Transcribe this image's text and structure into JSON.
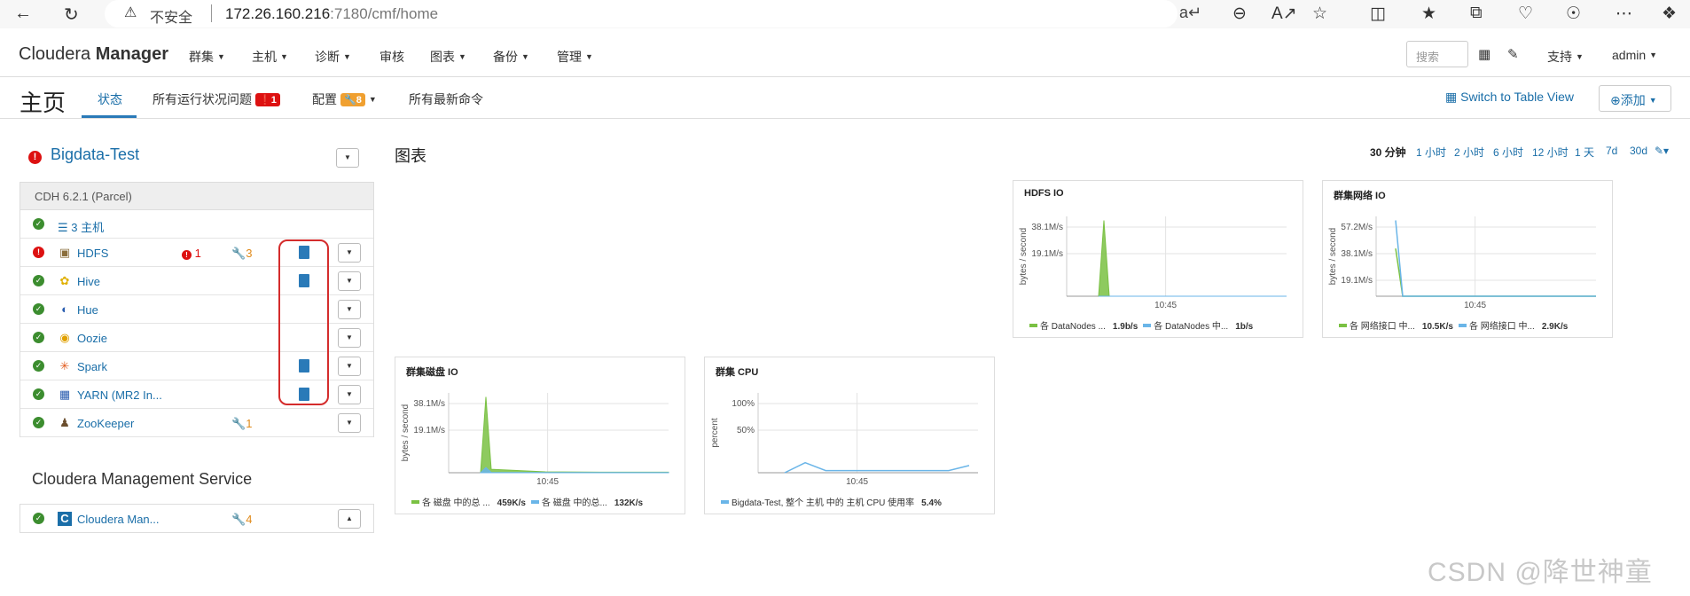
{
  "browser": {
    "security_warning": "不安全",
    "url_host": "172.26.160.216",
    "url_path": ":7180/cmf/home"
  },
  "header": {
    "logo_light": "Cloudera",
    "logo_bold": "Manager",
    "menus": [
      "群集",
      "主机",
      "诊断",
      "审核",
      "图表",
      "备份",
      "管理"
    ],
    "search_placeholder": "搜索",
    "support": "支持",
    "user": "admin"
  },
  "subheader": {
    "title": "主页",
    "tabs": [
      {
        "label": "状态",
        "active": true
      },
      {
        "label": "所有运行状况问题",
        "badge": "1"
      },
      {
        "label": "配置",
        "badge": "8"
      },
      {
        "label": "所有最新命令"
      }
    ],
    "table_view": "Switch to Table View",
    "add": "添加"
  },
  "cluster": {
    "name": "Bigdata-Test",
    "version": "CDH 6.2.1 (Parcel)",
    "hosts_link": "3 主机",
    "services": [
      {
        "name": "HDFS",
        "status": "error",
        "icon": "hdfs-icon",
        "errors": "1",
        "warnings": "3",
        "config_stale": true
      },
      {
        "name": "Hive",
        "status": "ok",
        "icon": "hive-icon",
        "config_stale": true
      },
      {
        "name": "Hue",
        "status": "ok",
        "icon": "hue-icon"
      },
      {
        "name": "Oozie",
        "status": "ok",
        "icon": "oozie-icon"
      },
      {
        "name": "Spark",
        "status": "ok",
        "icon": "spark-icon",
        "config_stale": true
      },
      {
        "name": "YARN (MR2 In...",
        "status": "ok",
        "icon": "yarn-icon",
        "config_stale": true
      },
      {
        "name": "ZooKeeper",
        "status": "ok",
        "icon": "zookeeper-icon",
        "warnings": "1"
      }
    ]
  },
  "management": {
    "title": "Cloudera Management Service",
    "service": {
      "name": "Cloudera Man...",
      "status": "ok",
      "warnings": "4"
    }
  },
  "charts": {
    "title": "图表",
    "time_ranges": [
      "30 分钟",
      "1 小时",
      "2 小时",
      "6 小时",
      "12 小时",
      "1 天",
      "7d",
      "30d"
    ],
    "selected_range": "30 分钟"
  },
  "colors": {
    "accent": "#1a6ea8",
    "green": "#7ac143",
    "blue": "#6ab5e8",
    "error": "#dd1111",
    "warning": "#f0a030"
  },
  "chart_data": [
    {
      "type": "area",
      "title": "HDFS IO",
      "ylabel": "bytes / second",
      "yticks": [
        "38.1M/s",
        "19.1M/s"
      ],
      "xticks": [
        "10:45"
      ],
      "series": [
        {
          "name": "各 DataNodes ...",
          "value": "1.9b/s",
          "color": "#7ac143",
          "values": [
            0,
            46000000,
            0,
            0,
            0,
            0
          ]
        },
        {
          "name": "各 DataNodes 中...",
          "value": "1b/s",
          "color": "#6ab5e8",
          "values": [
            0,
            0,
            0,
            0,
            0,
            0
          ]
        }
      ]
    },
    {
      "type": "line",
      "title": "群集网络 IO",
      "ylabel": "bytes / second",
      "yticks": [
        "57.2M/s",
        "38.1M/s",
        "19.1M/s"
      ],
      "xticks": [
        "10:45"
      ],
      "series": [
        {
          "name": "各 网络接口 中...",
          "value": "10.5K/s",
          "color": "#7ac143",
          "values": [
            36000000,
            0,
            0,
            0,
            0
          ]
        },
        {
          "name": "各 网络接口 中...",
          "value": "2.9K/s",
          "color": "#6ab5e8",
          "values": [
            57200000,
            0,
            0,
            0,
            0
          ]
        }
      ]
    },
    {
      "type": "area",
      "title": "群集磁盘 IO",
      "ylabel": "bytes / second",
      "yticks": [
        "38.1M/s",
        "19.1M/s"
      ],
      "xticks": [
        "10:45"
      ],
      "series": [
        {
          "name": "各 磁盘 中的总 ...",
          "value": "459K/s",
          "color": "#7ac143",
          "values": [
            0,
            44000000,
            2000000,
            500000,
            300000,
            300000
          ]
        },
        {
          "name": "各 磁盘 中的总...",
          "value": "132K/s",
          "color": "#6ab5e8",
          "values": [
            0,
            3000000,
            200000,
            100000,
            100000,
            100000
          ]
        }
      ]
    },
    {
      "type": "line",
      "title": "群集 CPU",
      "ylabel": "percent",
      "yticks": [
        "100%",
        "50%"
      ],
      "xticks": [
        "10:45"
      ],
      "series": [
        {
          "name": "Bigdata-Test, 整个 主机 中的 主机 CPU 使用率",
          "value": "5.4%",
          "color": "#6ab5e8",
          "values": [
            0,
            14,
            3,
            3,
            3,
            3,
            3,
            3,
            3,
            10
          ]
        }
      ]
    }
  ],
  "watermark": "CSDN @降世神童"
}
